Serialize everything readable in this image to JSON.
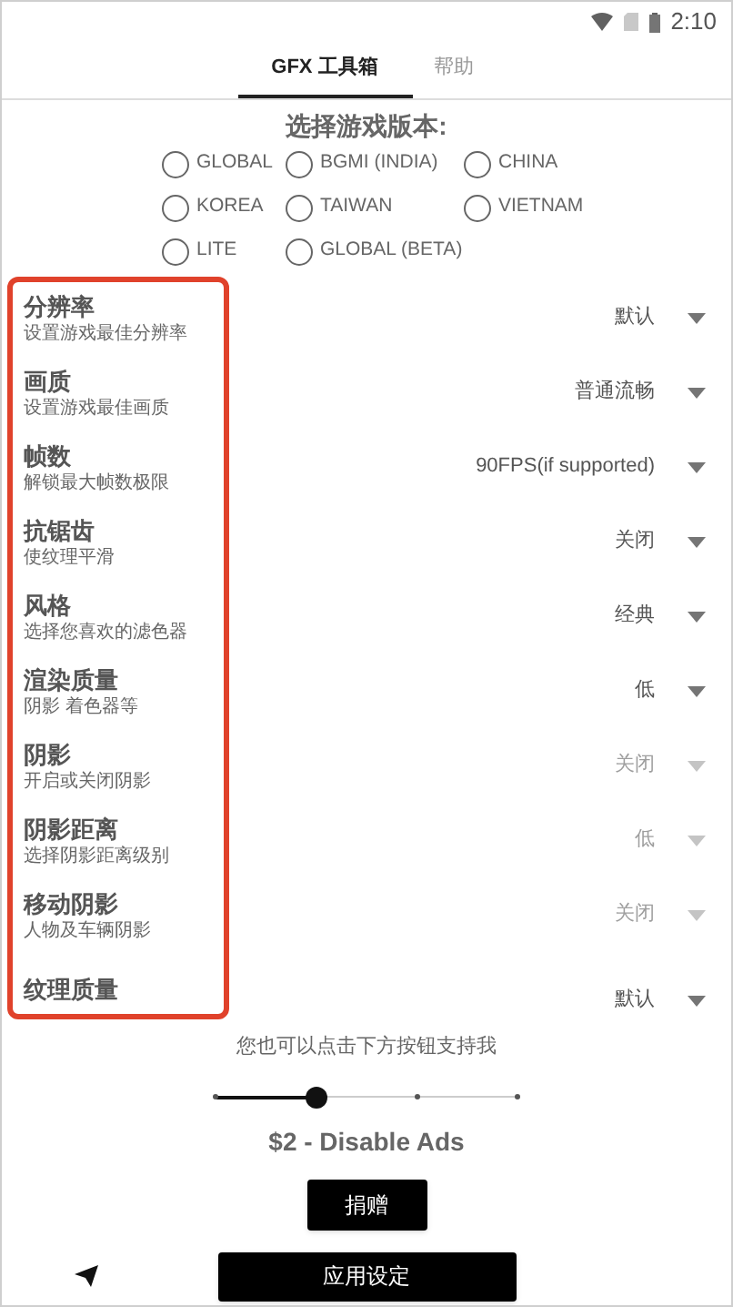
{
  "status_bar": {
    "time": "2:10"
  },
  "tabs": [
    {
      "label": "GFX 工具箱",
      "selected": true
    },
    {
      "label": "帮助",
      "selected": false
    }
  ],
  "version_picker": {
    "title": "选择游戏版本:",
    "options": [
      {
        "label": "GLOBAL",
        "selected": false
      },
      {
        "label": "BGMI (INDIA)",
        "selected": false
      },
      {
        "label": "CHINA",
        "selected": false
      },
      {
        "label": "KOREA",
        "selected": false
      },
      {
        "label": "TAIWAN",
        "selected": false
      },
      {
        "label": "VIETNAM",
        "selected": false
      },
      {
        "label": "LITE",
        "selected": false
      },
      {
        "label": "GLOBAL (BETA)",
        "selected": false
      }
    ]
  },
  "settings": {
    "highlighted": true,
    "rows": [
      {
        "title": "分辨率",
        "subtitle": "设置游戏最佳分辨率",
        "value": "默认",
        "disabled": false
      },
      {
        "title": "画质",
        "subtitle": "设置游戏最佳画质",
        "value": "普通流畅",
        "disabled": false
      },
      {
        "title": "帧数",
        "subtitle": "解锁最大帧数极限",
        "value": "90FPS(if supported)",
        "disabled": false
      },
      {
        "title": "抗锯齿",
        "subtitle": "使纹理平滑",
        "value": "关闭",
        "disabled": false
      },
      {
        "title": "风格",
        "subtitle": "选择您喜欢的滤色器",
        "value": "经典",
        "disabled": false
      },
      {
        "title": "渲染质量",
        "subtitle": "阴影 着色器等",
        "value": "低",
        "disabled": false
      },
      {
        "title": "阴影",
        "subtitle": "开启或关闭阴影",
        "value": "关闭",
        "disabled": true
      },
      {
        "title": "阴影距离",
        "subtitle": "选择阴影距离级别",
        "value": "低",
        "disabled": true
      },
      {
        "title": "移动阴影",
        "subtitle": "人物及车辆阴影",
        "value": "关闭",
        "disabled": true
      },
      {
        "title": "纹理质量",
        "value": "默认",
        "disabled": false
      }
    ]
  },
  "donate": {
    "prompt": "您也可以点击下方按钮支持我",
    "level": 0.333,
    "amount": "$2 - Disable Ads",
    "button": "捐赠"
  },
  "apply_button": "应用设定"
}
